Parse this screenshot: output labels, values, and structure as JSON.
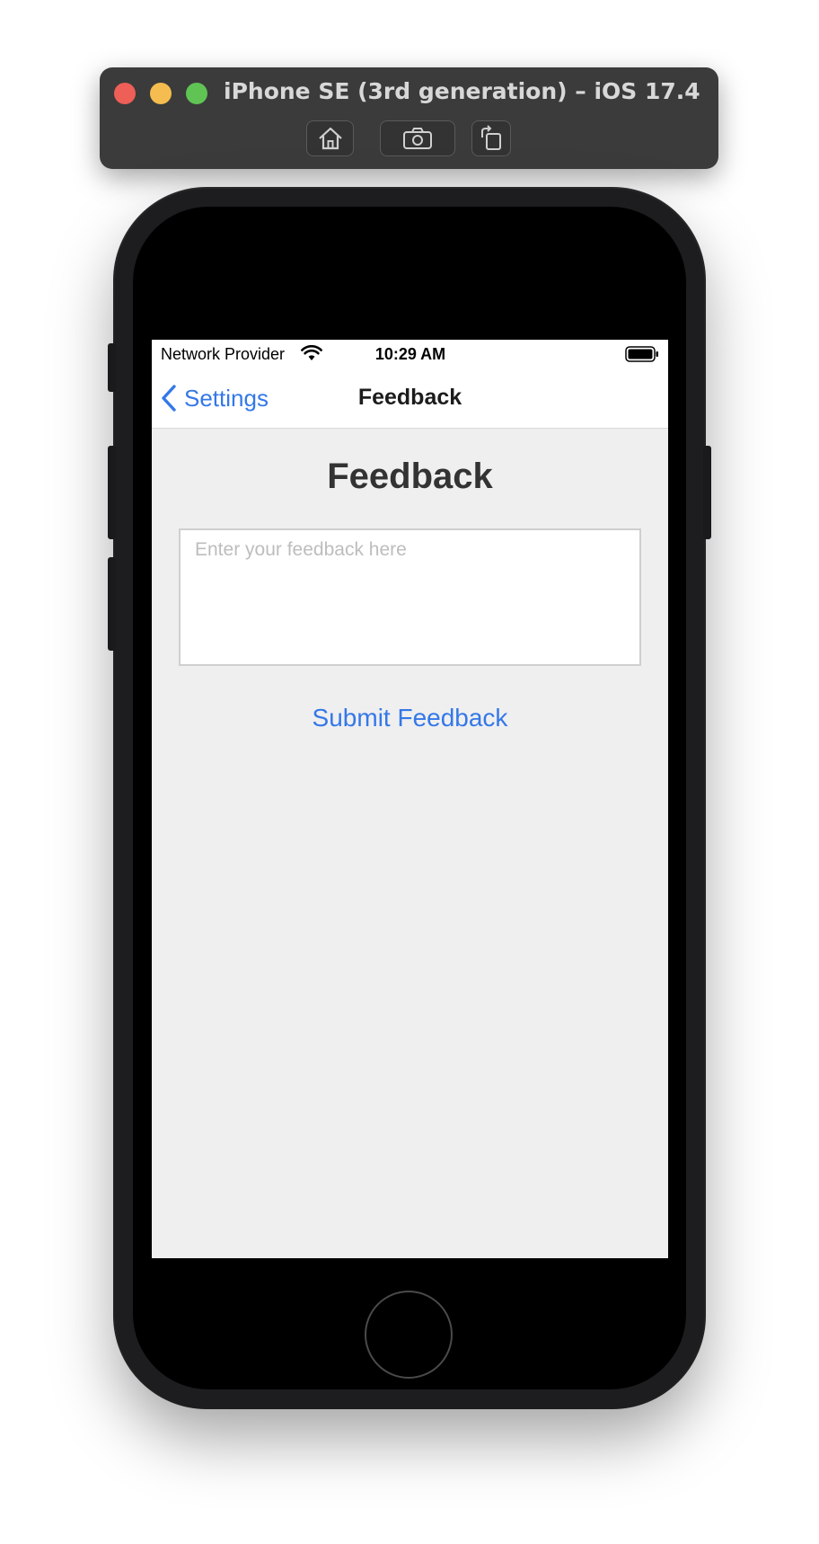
{
  "simulator": {
    "title": "iPhone SE (3rd generation) – iOS 17.4",
    "toolbar": [
      {
        "name": "home-icon"
      },
      {
        "name": "screenshot-icon"
      },
      {
        "name": "rotate-icon"
      }
    ]
  },
  "status_bar": {
    "carrier": "Network Provider",
    "time": "10:29 AM",
    "icons": [
      "wifi-icon",
      "battery-icon"
    ]
  },
  "nav_bar": {
    "back_label": "Settings",
    "title": "Feedback"
  },
  "content": {
    "heading": "Feedback",
    "input": {
      "value": "",
      "placeholder": "Enter your feedback here"
    },
    "submit_label": "Submit Feedback"
  },
  "colors": {
    "accent": "#3478e8",
    "background": "#efefef",
    "heading": "#333333"
  }
}
